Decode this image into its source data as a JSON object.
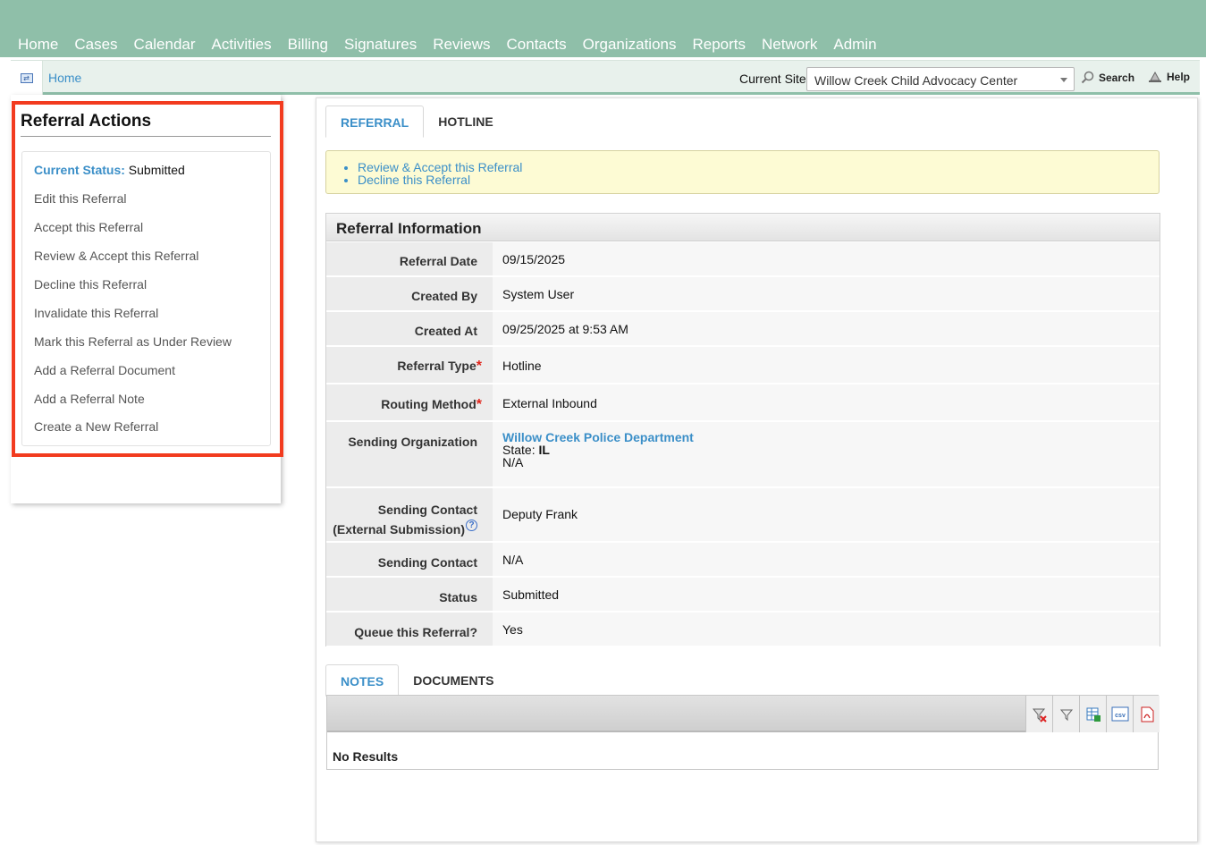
{
  "nav": [
    "Home",
    "Cases",
    "Calendar",
    "Activities",
    "Billing",
    "Signatures",
    "Reviews",
    "Contacts",
    "Organizations",
    "Reports",
    "Network",
    "Admin"
  ],
  "breadcrumb": {
    "home": "Home"
  },
  "site": {
    "label": "Current Site",
    "value": "Willow Creek Child Advocacy Center"
  },
  "tools": {
    "search": "Search",
    "help": "Help"
  },
  "actions": {
    "title": "Referral Actions",
    "status_label": "Current Status:",
    "status_value": "Submitted",
    "items": [
      "Edit this Referral",
      "Accept this Referral",
      "Review & Accept this Referral",
      "Decline this Referral",
      "Invalidate this Referral",
      "Mark this Referral as Under Review",
      "Add a Referral Document",
      "Add a Referral Note",
      "Create a New Referral"
    ]
  },
  "top_tabs": [
    "REFERRAL",
    "HOTLINE"
  ],
  "notice": [
    "Review & Accept this Referral",
    "Decline this Referral"
  ],
  "info": {
    "title": "Referral Information",
    "referral_date_label": "Referral Date",
    "referral_date": "09/15/2025",
    "created_by_label": "Created By",
    "created_by": "System User",
    "created_at_label": "Created At",
    "created_at": "09/25/2025 at 9:53 AM",
    "referral_type_label": "Referral Type",
    "referral_type": "Hotline",
    "routing_method_label": "Routing Method",
    "routing_method": "External Inbound",
    "sending_org_label": "Sending Organization",
    "sending_org": "Willow Creek Police Department",
    "state_label": "State:",
    "state_value": "IL",
    "org_extra": "N/A",
    "sending_contact_ext_label_1": "Sending Contact",
    "sending_contact_ext_label_2": "(External Submission)",
    "sending_contact_ext": "Deputy Frank",
    "sending_contact_label": "Sending Contact",
    "sending_contact": "N/A",
    "status_label": "Status",
    "status": "Submitted",
    "queue_label": "Queue this Referral?",
    "queue": "Yes"
  },
  "bottom_tabs": [
    "NOTES",
    "DOCUMENTS"
  ],
  "grid": {
    "empty": "No Results",
    "csv_label": "csv"
  }
}
